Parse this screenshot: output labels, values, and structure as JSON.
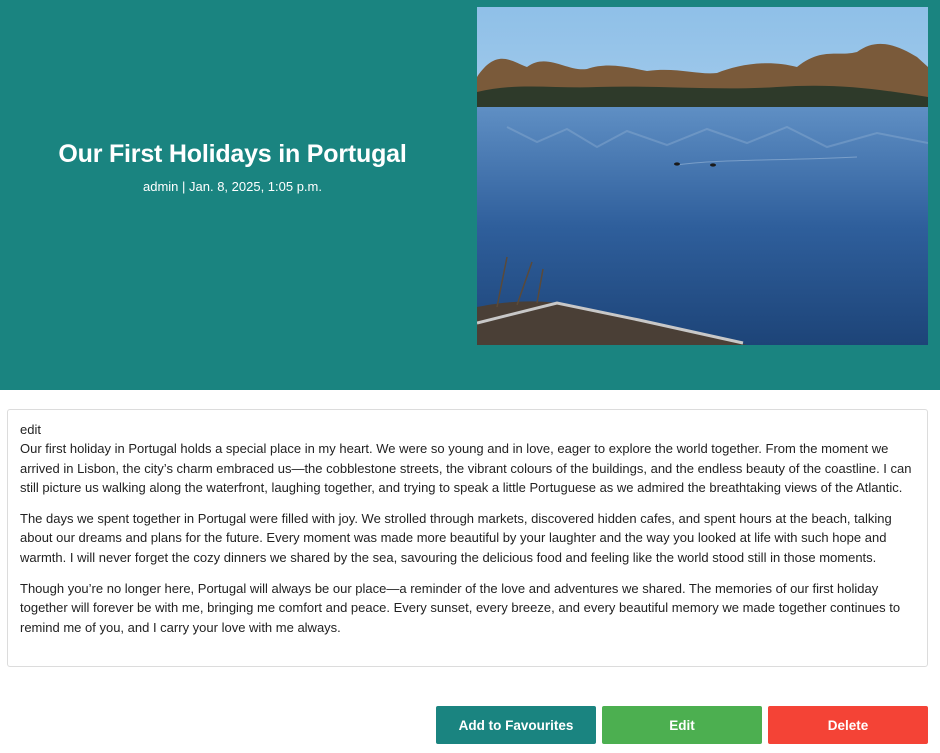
{
  "post": {
    "title": "Our First Holidays in Portugal",
    "meta": "admin | Jan. 8, 2025, 1:05 p.m.",
    "edit_label": "edit",
    "paragraphs": [
      "Our first holiday in Portugal holds a special place in my heart. We were so young and in love, eager to explore the world together. From the moment we arrived in Lisbon, the city’s charm embraced us—the cobblestone streets, the vibrant colours of the buildings, and the endless beauty of the coastline. I can still picture us walking along the waterfront, laughing together, and trying to speak a little Portuguese as we admired the breathtaking views of the Atlantic.",
      "The days we spent together in Portugal were filled with joy. We strolled through markets, discovered hidden cafes, and spent hours at the beach, talking about our dreams and plans for the future. Every moment was made more beautiful by your laughter and the way you looked at life with such hope and warmth. I will never forget the cozy dinners we shared by the sea, savouring the delicious food and feeling like the world stood still in those moments.",
      "Though you’re no longer here, Portugal will always be our place—a reminder of the love and adventures we shared. The memories of our first holiday together will forever be with me, bringing me comfort and peace. Every sunset, every breeze, and every beautiful memory we made together continues to remind me of you, and I carry your love with me always."
    ]
  },
  "actions": {
    "favourite_label": "Add to Favourites",
    "edit_label": "Edit",
    "delete_label": "Delete"
  },
  "colors": {
    "header_bg": "#1a8480",
    "favourite": "#1a8480",
    "edit": "#4caf50",
    "delete": "#f44336"
  }
}
